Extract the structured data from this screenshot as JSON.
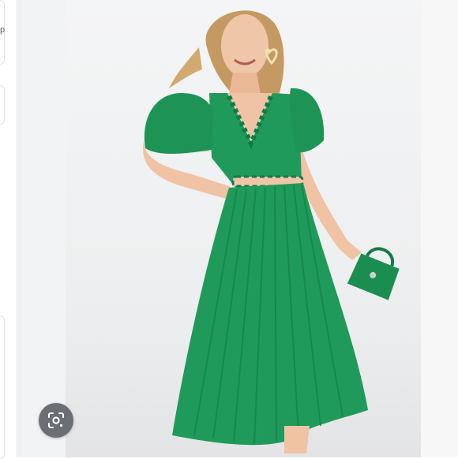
{
  "left_fragment": {
    "text": "p"
  },
  "image": {
    "subject": "green-pleated-midi-dress",
    "colors": {
      "dress": "#1f9a5a",
      "dress_shadow": "#14804a",
      "skin": "#f0c6a8",
      "hair": "#c59a62",
      "background": "#efefef"
    }
  },
  "lens_button": {
    "icon": "google-lens-icon"
  }
}
